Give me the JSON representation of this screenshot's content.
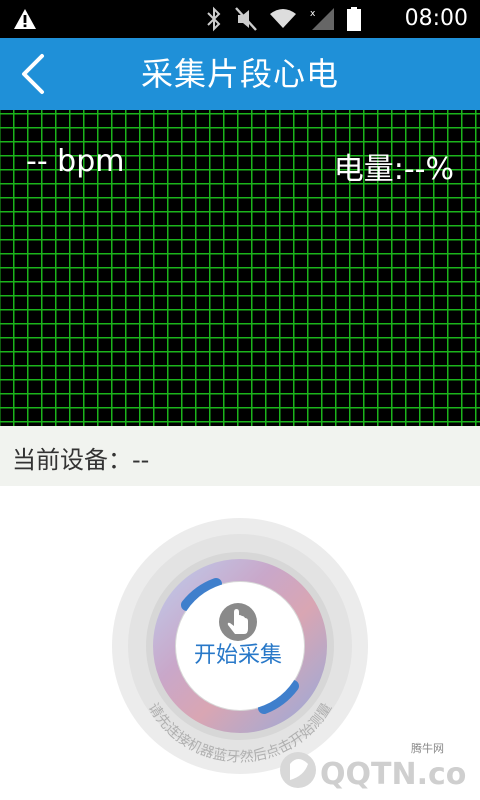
{
  "status_bar": {
    "time": "08:00",
    "icons": [
      "warning-icon",
      "bluetooth-icon",
      "mute-icon",
      "wifi-icon",
      "signal-icon",
      "battery-icon"
    ]
  },
  "header": {
    "title": "采集片段心电",
    "back_icon": "chevron-left-icon",
    "color": "#1f90d8"
  },
  "ecg_panel": {
    "bpm_text": "-- bpm",
    "battery_text": "电量:--%",
    "grid_color": "#1bb41b"
  },
  "device": {
    "label": "当前设备：--"
  },
  "start_control": {
    "button_label": "开始采集",
    "hint_text": "请先连接机器蓝牙然后点击开始测量",
    "icon": "touch-icon"
  },
  "watermark": {
    "small_text": "腾牛网",
    "brand": "QQTN.com"
  }
}
